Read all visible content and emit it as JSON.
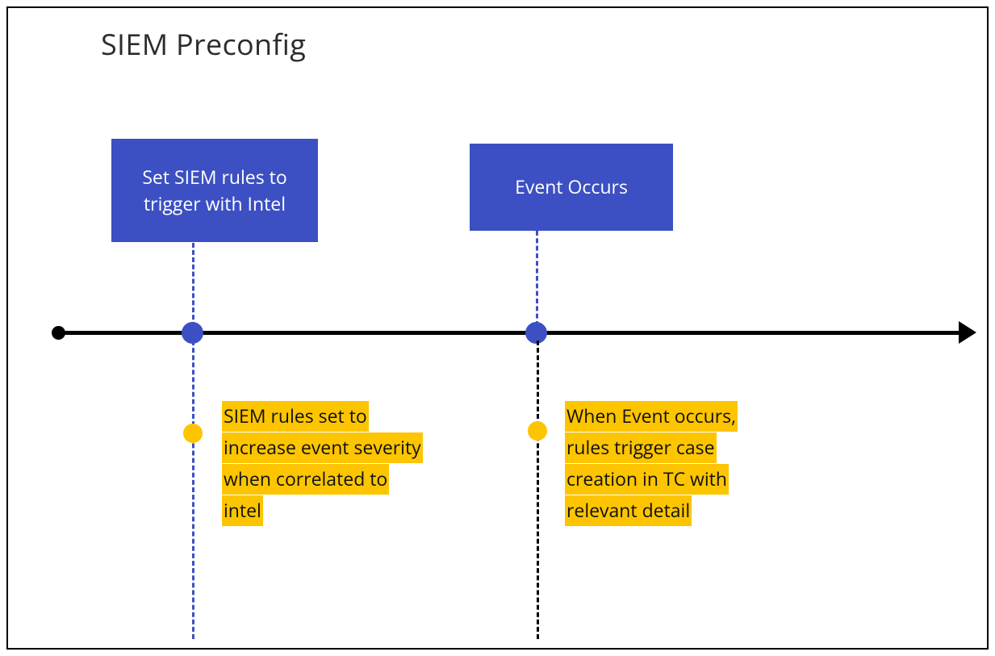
{
  "title": "SIEM Preconfig",
  "timeline": {
    "events": [
      {
        "label": "Set SIEM rules to trigger with Intel",
        "note": " SIEM rules set to increase  event severity when correlated to intel"
      },
      {
        "label": "Event Occurs",
        "note": "When Event occurs, rules trigger case creation in TC with relevant detail"
      }
    ]
  },
  "colors": {
    "box": "#3c50c3",
    "highlight": "#fdc500",
    "line": "#000000"
  }
}
